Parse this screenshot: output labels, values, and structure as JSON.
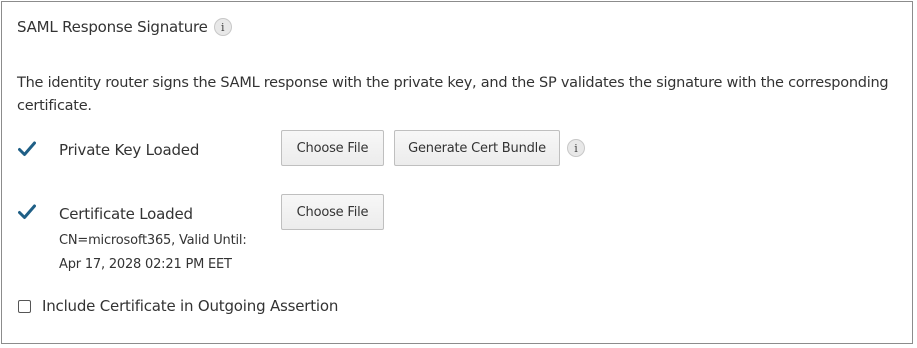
{
  "section": {
    "title": "SAML Response Signature",
    "info_icon": "i",
    "description": "The identity router signs the SAML response with the private key, and the SP validates the signature with the corresponding certificate."
  },
  "private_key": {
    "status_icon": "checkmark-icon",
    "status_color": "#1f5f86",
    "label": "Private Key Loaded",
    "choose_file_label": "Choose File",
    "generate_label": "Generate Cert Bundle",
    "info_icon": "i"
  },
  "certificate": {
    "status_icon": "checkmark-icon",
    "status_color": "#1f5f86",
    "label": "Certificate Loaded",
    "cn_line": "CN=microsoft365, Valid Until:",
    "valid_until": "Apr 17, 2028 02:21 PM EET",
    "choose_file_label": "Choose File"
  },
  "include_cert": {
    "label": "Include Certificate in Outgoing Assertion",
    "checked": false
  }
}
